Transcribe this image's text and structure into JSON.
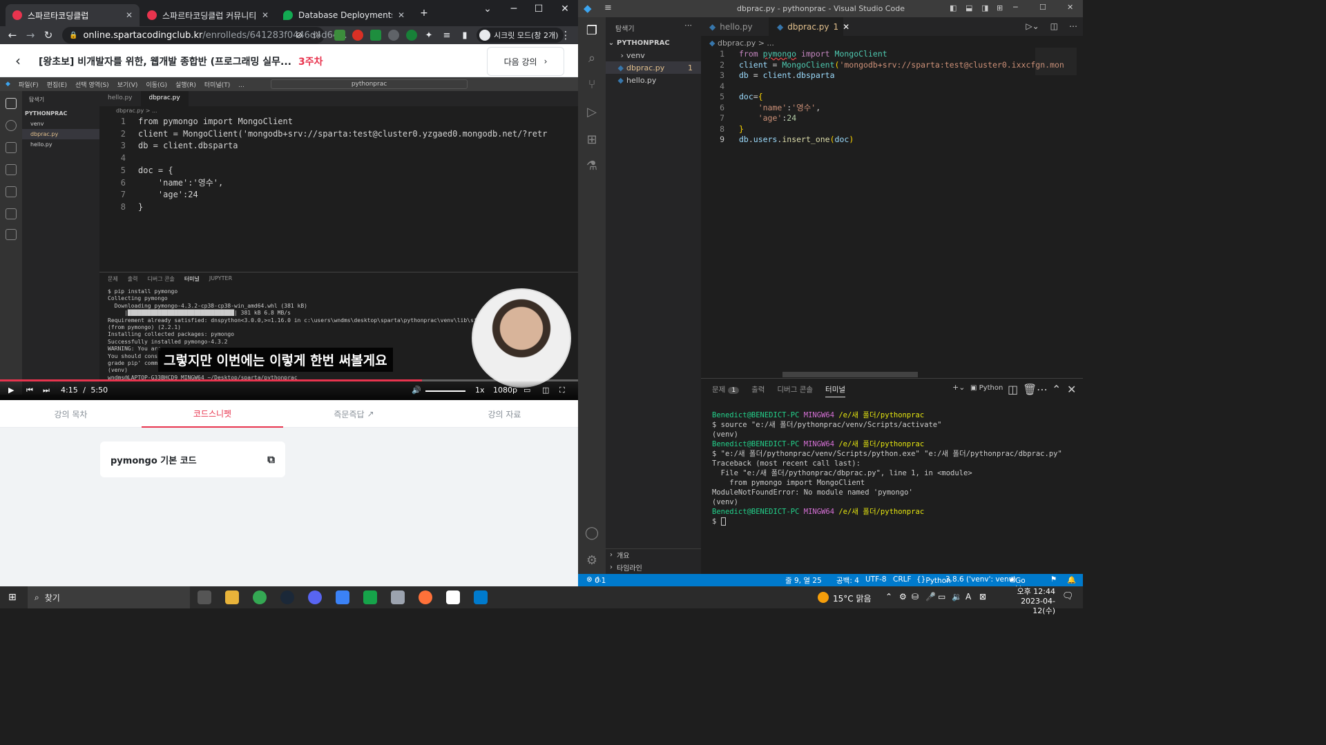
{
  "chrome": {
    "tabs": [
      {
        "title": "스파르타코딩클럽"
      },
      {
        "title": "스파르타코딩클럽 커뮤니티 | 스"
      },
      {
        "title": "Database Deployments | Cloud"
      }
    ],
    "url_host": "online.spartacodingclub.kr",
    "url_path": "/enrolleds/641283f0446d4d64...",
    "incognito_label": "시크릿 모드(창 2개)"
  },
  "course": {
    "title": "[왕초보] 비개발자를 위한, 웹개발 종합반 (프로그래밍 실무...",
    "week": "3주차",
    "next_label": "다음 강의"
  },
  "video": {
    "vscode_menu": [
      "파일(F)",
      "편집(E)",
      "선택 영역(S)",
      "보기(V)",
      "이동(G)",
      "실행(R)",
      "터미널(T)",
      "..."
    ],
    "search_text": "pythonprac",
    "explorer_title": "탐색기",
    "project": "PYTHONPRAC",
    "files": [
      "venv",
      "dbprac.py",
      "hello.py"
    ],
    "tabs": [
      "hello.py",
      "dbprac.py"
    ],
    "breadcrumb": "dbprac.py > ...",
    "code": [
      "from pymongo import MongoClient",
      "client = MongoClient('mongodb+srv://sparta:test@cluster0.yzgaed0.mongodb.net/?retr",
      "db = client.dbsparta",
      "",
      "doc = {",
      "    'name':'영수',",
      "    'age':24",
      "}"
    ],
    "panel_tabs": [
      "문제",
      "출력",
      "디버그 콘솔",
      "터미널",
      "JUPYTER"
    ],
    "terminal": "$ pip install pymongo\nCollecting pymongo\n  Downloading pymongo-4.3.2-cp38-cp38-win_amd64.whl (381 kB)\n     |████████████████████████████████| 381 kB 6.8 MB/s\nRequirement already satisfied: dnspython<3.0.0,>=1.16.0 in c:\\users\\wndms\\desktop\\sparta\\pythonprac\\venv\\lib\\si\n(from pymongo) (2.2.1)\nInstalling collected packages: pymongo\nSuccessfully installed pymongo-4.3.2\nWARNING: You are\nYou should cons\ngrade pip' comm\n(venv)\nwndms@LAPTOP-G33BHCD9 MINGW64 ~/Desktop/sparta/pythonprac",
    "subtitle": "그렇지만 이번에는 이렇게 한번 써볼게요",
    "time_current": "4:15",
    "time_sep": "/",
    "time_total": "5:50",
    "progress": 0.73,
    "speed": "1x",
    "quality": "1080p"
  },
  "content_tabs": [
    "강의 목차",
    "코드스니펫",
    "즉문즉답",
    "강의 자료"
  ],
  "snippet": {
    "title": "pymongo 기본 코드"
  },
  "vscode": {
    "title": "dbprac.py - pythonprac - Visual Studio Code",
    "explorer_title": "탐색기",
    "project": "PYTHONPRAC",
    "files": [
      {
        "name": "venv"
      },
      {
        "name": "dbprac.py",
        "badge": "1"
      },
      {
        "name": "hello.py"
      }
    ],
    "outline": "개요",
    "timeline": "타임라인",
    "tabs": [
      {
        "name": "hello.py"
      },
      {
        "name": "dbprac.py",
        "badge": "1"
      }
    ],
    "breadcrumb": "dbprac.py > ...",
    "panel_tabs": [
      "문제",
      "출력",
      "디버그 콘솔",
      "터미널"
    ],
    "problems_count": "1",
    "terminal_kind": "Python",
    "terminal": [
      {
        "user": "Benedict@BENEDICT-PC",
        "sys": "MINGW64",
        "path": "/e/새 폴더/pythonprac"
      },
      {
        "text": "$ source \"e:/새 폴더/pythonprac/venv/Scripts/activate\""
      },
      {
        "text": "(venv)"
      },
      {
        "user": "Benedict@BENEDICT-PC",
        "sys": "MINGW64",
        "path": "/e/새 폴더/pythonprac"
      },
      {
        "text": "$ \"e:/새 폴더/pythonprac/venv/Scripts/python.exe\" \"e:/새 폴더/pythonprac/dbprac.py\""
      },
      {
        "text": "Traceback (most recent call last):"
      },
      {
        "text": "  File \"e:/새 폴더/pythonprac/dbprac.py\", line 1, in <module>"
      },
      {
        "text": "    from pymongo import MongoClient"
      },
      {
        "text": "ModuleNotFoundError: No module named 'pymongo'"
      },
      {
        "text": "(venv)"
      },
      {
        "user": "Benedict@BENEDICT-PC",
        "sys": "MINGW64",
        "path": "/e/새 폴더/pythonprac"
      },
      {
        "text": "$ "
      }
    ],
    "status": {
      "errors": "0",
      "warnings": "1",
      "position": "줄 9, 열 25",
      "spaces": "공백: 4",
      "encoding": "UTF-8",
      "eol": "CRLF",
      "language": "Python",
      "interpreter": "3.8.6 ('venv': venv)",
      "golive": "Go Live"
    }
  },
  "taskbar": {
    "search": "찾기",
    "weather": "15°C 맑음",
    "time": "오후 12:44",
    "date": "2023-04-12(수)"
  }
}
